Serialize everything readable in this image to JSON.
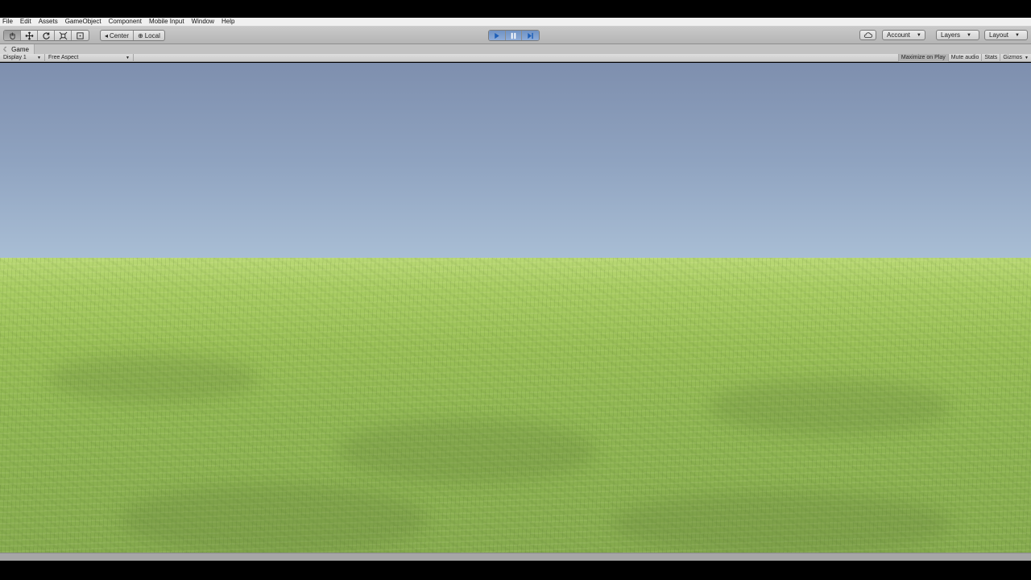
{
  "menu": [
    "File",
    "Edit",
    "Assets",
    "GameObject",
    "Component",
    "Mobile Input",
    "Window",
    "Help"
  ],
  "toolbar": {
    "tools": [
      "hand-tool-icon",
      "move-tool-icon",
      "rotate-tool-icon",
      "scale-tool-icon",
      "rect-tool-icon"
    ],
    "pivot_center_label": "Center",
    "pivot_local_label": "Local",
    "playback": [
      "play-icon",
      "pause-icon",
      "step-icon"
    ],
    "cloud_icon": "cloud-icon",
    "account_label": "Account",
    "layers_label": "Layers",
    "layout_label": "Layout"
  },
  "game_view": {
    "tab_label": "Game",
    "tab_icon": "game-controller-icon",
    "display_label": "Display 1",
    "aspect_label": "Free Aspect",
    "maximize_label": "Maximize on Play",
    "mute_label": "Mute audio",
    "stats_label": "Stats",
    "gizmos_label": "Gizmos"
  },
  "colors": {
    "sky_top": "#7e8fae",
    "sky_horizon": "#eef6f6",
    "grass": "#9fc45a",
    "play_active": "#7b9dcf"
  }
}
